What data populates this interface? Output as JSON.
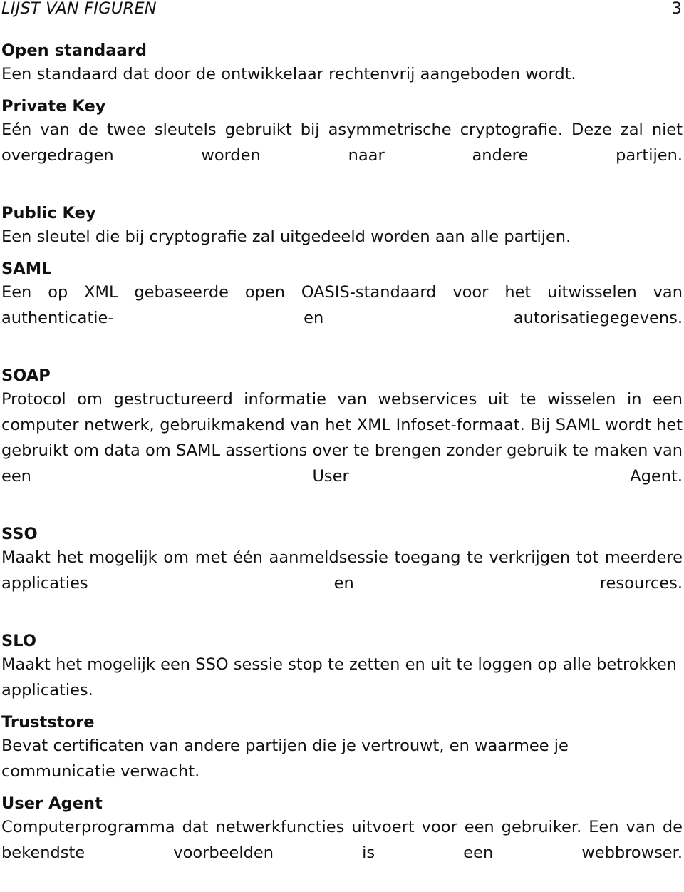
{
  "document": {
    "language": "nl",
    "page_kind": "glossary",
    "text_color": "#111111",
    "background_color": "#ffffff"
  },
  "header": {
    "title": "LIJST VAN FIGUREN",
    "page_number": "3"
  },
  "glossary": {
    "entries": [
      {
        "term": "Open standaard",
        "definition": "Een standaard dat door de ontwikkelaar rechtenvrij aangeboden wordt.",
        "lines": 1
      },
      {
        "term": "Private Key",
        "definition": "Eén van de twee sleutels gebruikt bij asymmetrische cryptografie.  Deze zal niet overgedragen worden naar andere partijen.",
        "lines": 2
      },
      {
        "term": "Public Key",
        "definition": "Een sleutel die bij cryptografie zal uitgedeeld worden aan alle partijen.",
        "lines": 1
      },
      {
        "term": "SAML",
        "definition": "Een op XML gebaseerde open OASIS-standaard voor het uitwisselen van authenticatie- en autorisatiegegevens.",
        "lines": 2
      },
      {
        "term": "SOAP",
        "definition": "Protocol om gestructureerd informatie van webservices uit te wisselen in een computer netwerk, gebruikmakend van het XML Infoset-formaat.  Bij SAML wordt het gebruikt om data om SAML assertions over te brengen zonder gebruik te maken van een User Agent.",
        "lines": 3
      },
      {
        "term": "SSO",
        "definition": "Maakt het mogelijk om met één aanmeldsessie toegang te verkrijgen tot meerdere applicaties en resources.",
        "lines": 2
      },
      {
        "term": "SLO",
        "definition": "Maakt het mogelijk een SSO sessie stop te zetten en uit te loggen op alle betrokken applicaties.",
        "lines": 1
      },
      {
        "term": "Truststore",
        "definition": "Bevat certificaten van andere partijen die je vertrouwt, en waarmee je communicatie verwacht.",
        "lines": 1
      },
      {
        "term": "User Agent",
        "definition": "Computerprogramma dat netwerkfuncties uitvoert voor een gebruiker.  Een van de bekendste voorbeelden is een webbrowser.",
        "lines": 2
      }
    ]
  }
}
